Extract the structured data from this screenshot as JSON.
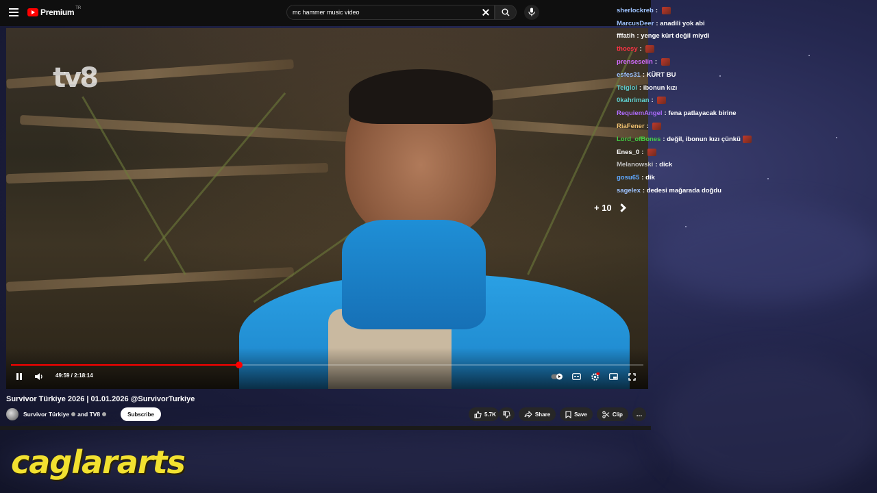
{
  "youtube": {
    "logo_text": "Premium",
    "logo_country": "TR",
    "search": {
      "value": "mc hammer music video"
    }
  },
  "video": {
    "watermark": "tv8",
    "skip_label": "+ 10",
    "time_display": "49:59 / 2:18:14",
    "progress": 0.3611,
    "title": "Survivor Türkiye 2026 | 01.01.2026 @SurvivorTurkiye",
    "channel_name": "Survivor Türkiye",
    "channel_joiner": "and TV8",
    "subscribe_label": "Subscribe",
    "like_count": "5.7K",
    "share_label": "Share",
    "save_label": "Save",
    "clip_label": "Clip",
    "more_label": "..."
  },
  "overlay": {
    "brand": "caglararts"
  },
  "chat": {
    "messages": [
      {
        "user": "sherlockreb",
        "color": "#9ec3ff",
        "text": "",
        "emote": true
      },
      {
        "user": "MarcusDeer",
        "color": "#9ec3ff",
        "text": "anadili yok abi",
        "emote": false
      },
      {
        "user": "fffatih",
        "color": "#ffffff",
        "text": "yenge kürt değil miydi",
        "emote": false
      },
      {
        "user": "thoesy",
        "color": "#ff3344",
        "text": "",
        "emote": true
      },
      {
        "user": "prenseselin",
        "color": "#d36cff",
        "text": "",
        "emote": true
      },
      {
        "user": "esfes31",
        "color": "#9ec3ff",
        "text": "KÜRT BU",
        "emote": false
      },
      {
        "user": "Teiglol",
        "color": "#5fd0d0",
        "text": "ibonun kızı",
        "emote": false
      },
      {
        "user": "0kahriman",
        "color": "#5fd0d0",
        "text": "",
        "emote": true
      },
      {
        "user": "RequiemAngel",
        "color": "#b06cff",
        "text": "fena patlayacak birine",
        "emote": false
      },
      {
        "user": "RiaFener",
        "color": "#f0c070",
        "text": "",
        "emote": true
      },
      {
        "user": "Lord_ofBones",
        "color": "#44d044",
        "text": "değil, ibonun kızı çünkü",
        "emote": true
      },
      {
        "user": "Enes_0",
        "color": "#ffffff",
        "text": "",
        "emote": true
      },
      {
        "user": "Melanowski",
        "color": "#c0c0c0",
        "text": "dick",
        "emote": false
      },
      {
        "user": "gosu65",
        "color": "#5fa8ff",
        "text": "dik",
        "emote": false
      },
      {
        "user": "sagelex",
        "color": "#9ec3ff",
        "text": "dedesi mağarada doğdu",
        "emote": false
      }
    ]
  },
  "colors": {
    "accent": "#ff0000",
    "brand_yellow": "#f2e130"
  }
}
